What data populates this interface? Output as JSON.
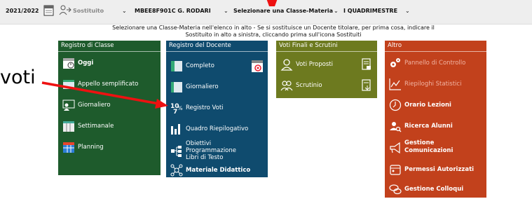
{
  "topbar": {
    "year": "2021/2022",
    "substitute_label": "Sostituito",
    "school": "MBEE8F901C G. RODARI",
    "class_subject": "Selezionare una Classe-Materia",
    "period": "I QUADRIMESTRE"
  },
  "notice": {
    "line1": "Selezionare una Classe-Materia nell'elenco in alto - Se si sostituisce un Docente titolare, per prima cosa, indicare il",
    "line2": "Sostituito in alto a sinistra, cliccando prima sull'icona Sostituiti"
  },
  "annotation": {
    "text": "voti",
    "arrow_color": "#ee1111"
  },
  "panels": {
    "classe": {
      "title": "Registro di Classe",
      "color": "#1e5b2c",
      "items": [
        {
          "label": "Oggi",
          "icon": "calendar-icon"
        },
        {
          "label": "Appello semplificato",
          "icon": "checklist-icon"
        },
        {
          "label": "Giornaliero",
          "icon": "teacher-icon"
        },
        {
          "label": "Settimanale",
          "icon": "week-icon"
        },
        {
          "label": "Planning",
          "icon": "grid-icon"
        }
      ]
    },
    "docente": {
      "title": "Registro del Docente",
      "color": "#0f4b6e",
      "items": [
        {
          "label": "Completo",
          "icon": "book-icon"
        },
        {
          "label": "Giornaliero",
          "icon": "page-icon"
        },
        {
          "label": "Registro Voti",
          "icon": "grades-icon"
        },
        {
          "label": "Quadro Riepilogativo",
          "icon": "bars-icon"
        },
        {
          "label": "Obiettivi Programmazione Libri di Testo",
          "lines": [
            "Obiettivi",
            "Programmazione",
            "Libri di Testo"
          ],
          "icon": "tree-icon"
        },
        {
          "label": "Materiale Didattico",
          "icon": "network-icon"
        }
      ]
    },
    "voti": {
      "title": "Voti Finali e Scrutini",
      "color": "#6d7a1f",
      "items": [
        {
          "label": "Voti Proposti",
          "icon": "person-icon"
        },
        {
          "label": "Scrutinio",
          "icon": "people-icon"
        }
      ]
    },
    "altro": {
      "title": "Altro",
      "color": "#c2411c",
      "items": [
        {
          "label": "Pannello di Controllo",
          "icon": "gears-icon"
        },
        {
          "label": "Riepiloghi Statistici",
          "icon": "chart-icon"
        },
        {
          "label": "Orario Lezioni",
          "icon": "clock-icon"
        },
        {
          "label": "Ricerca Alunni",
          "icon": "search-user-icon"
        },
        {
          "label": "Gestione Comunicazioni",
          "lines": [
            "Gestione",
            "Comunicazioni"
          ],
          "icon": "megaphone-icon"
        },
        {
          "label": "Permessi Autorizzati",
          "icon": "permit-icon"
        },
        {
          "label": "Gestione Colloqui",
          "icon": "talk-icon"
        }
      ]
    }
  }
}
